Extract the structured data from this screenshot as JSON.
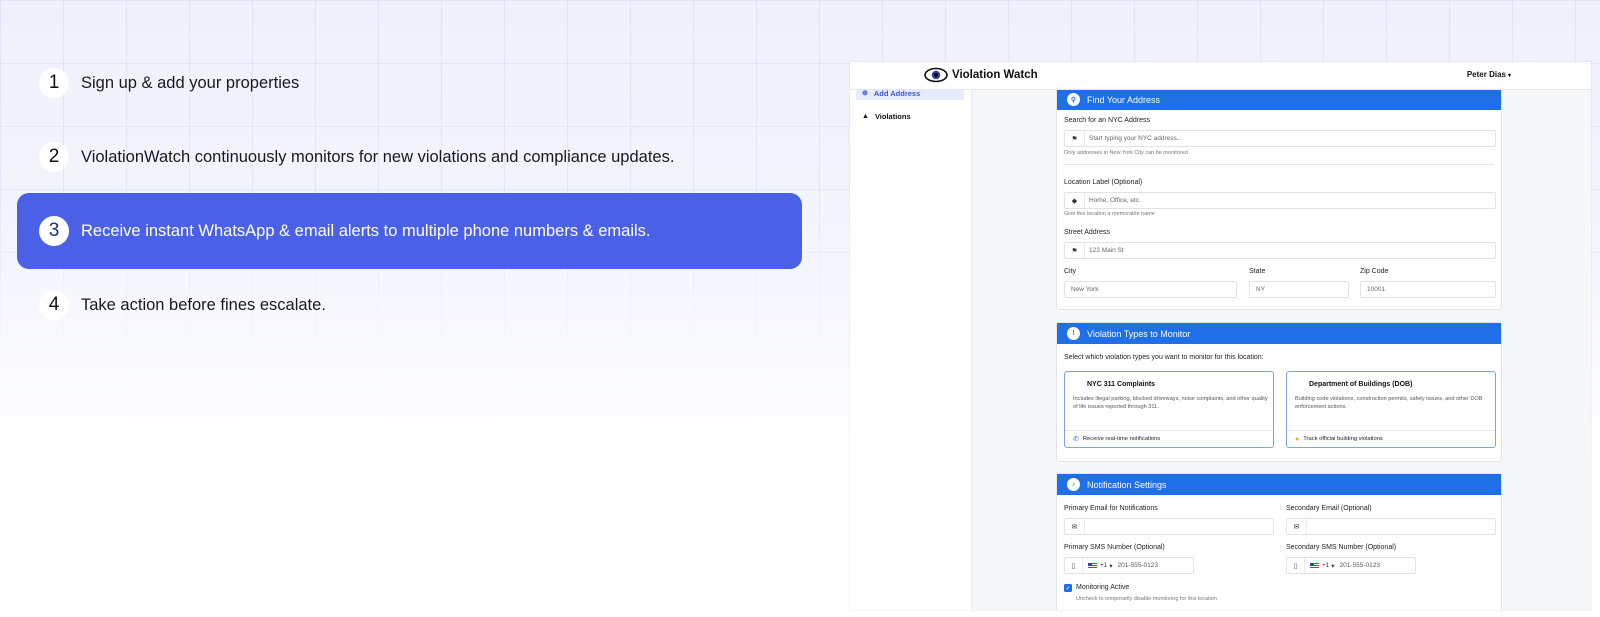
{
  "steps": [
    {
      "num": "1",
      "text": "Sign up & add your properties"
    },
    {
      "num": "2",
      "text": "ViolationWatch continuously monitors for new violations and compliance updates."
    },
    {
      "num": "3",
      "text": "Receive instant WhatsApp & email alerts to multiple phone numbers & emails."
    },
    {
      "num": "4",
      "text": "Take action before fines escalate."
    }
  ],
  "active_step": 3,
  "app": {
    "brand": "Violation Watch",
    "user": "Peter Dias",
    "sidebar": [
      {
        "label": "Add Address",
        "icon": "plus-circle-icon",
        "selected": true
      },
      {
        "label": "Violations",
        "icon": "warning-icon",
        "selected": false
      }
    ],
    "find_address": {
      "title": "Find Your Address",
      "search_label": "Search for an NYC Address",
      "search_placeholder": "Start typing your NYC address...",
      "search_hint": "Only addresses in New York City can be monitored",
      "location_label": "Location Label (Optional)",
      "location_placeholder": "Home, Office, etc.",
      "location_hint": "Give this location a memorable name",
      "street_label": "Street Address",
      "street_placeholder": "123 Main St",
      "city_label": "City",
      "city_placeholder": "New York",
      "state_label": "State",
      "state_placeholder": "NY",
      "zip_label": "Zip Code",
      "zip_placeholder": "10001"
    },
    "violation_types": {
      "title": "Violation Types to Monitor",
      "intro": "Select which violation types you want to monitor for this location:",
      "tiles": [
        {
          "title": "NYC 311 Complaints",
          "desc": "Includes illegal parking, blocked driveways, noise complaints, and other quality of life issues reported through 311.",
          "footer": "Receive real-time notifications",
          "icon": "phone-icon"
        },
        {
          "title": "Department of Buildings (DOB)",
          "desc": "Building code violations, construction permits, safety issues, and other DOB enforcement actions.",
          "footer": "Track official building violations",
          "icon": "hardhat-icon"
        }
      ]
    },
    "notifications": {
      "title": "Notification Settings",
      "primary_email_label": "Primary Email for Notifications",
      "secondary_email_label": "Secondary Email (Optional)",
      "primary_sms_label": "Primary SMS Number (Optional)",
      "secondary_sms_label": "Secondary SMS Number (Optional)",
      "country_code": "+1",
      "sms_placeholder": "201-555-0123",
      "monitoring_label": "Monitoring Active",
      "monitoring_hint": "Uncheck to temporarily disable monitoring for this location",
      "monitoring_checked": true
    }
  },
  "colors": {
    "accent": "#4a60e6",
    "header_blue": "#1f6fe8"
  }
}
